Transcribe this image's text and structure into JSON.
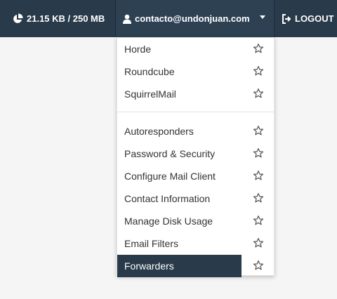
{
  "topbar": {
    "disk_usage": "21.15 KB / 250 MB",
    "user_email": "contacto@undonjuan.com",
    "logout_label": "LOGOUT"
  },
  "menu": {
    "webmail_items": [
      {
        "label": "Horde"
      },
      {
        "label": "Roundcube"
      },
      {
        "label": "SquirrelMail"
      }
    ],
    "settings_items": [
      {
        "label": "Autoresponders"
      },
      {
        "label": "Password & Security"
      },
      {
        "label": "Configure Mail Client"
      },
      {
        "label": "Contact Information"
      },
      {
        "label": "Manage Disk Usage"
      },
      {
        "label": "Email Filters"
      },
      {
        "label": "Forwarders",
        "active": true
      }
    ]
  },
  "colors": {
    "topbar_bg": "#293a4a",
    "active_bg": "#293a4a"
  },
  "icons": {
    "disk": "pie-chart-icon",
    "user": "user-icon",
    "logout": "sign-out-icon",
    "favorite": "star-outline-icon"
  }
}
